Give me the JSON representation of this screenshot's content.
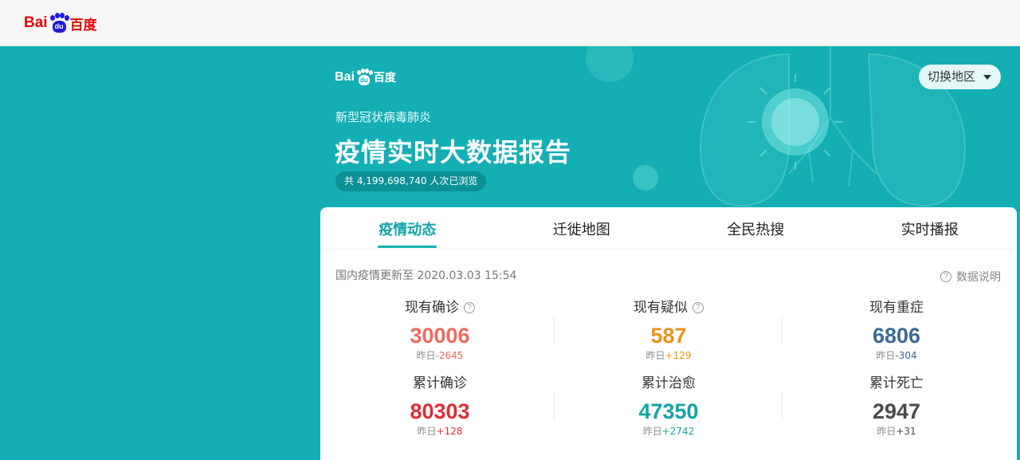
{
  "topbar": {
    "logo": {
      "bai": "Bai",
      "du": "du",
      "cn": "百度"
    }
  },
  "banner": {
    "logo": {
      "bai": "Bai",
      "du": "du",
      "cn": "百度"
    },
    "subtitle": "新型冠状病毒肺炎",
    "title": "疫情实时大数据报告",
    "views": "共 4,199,698,740 人次已浏览",
    "region_button": "切换地区"
  },
  "tabs": [
    {
      "label": "疫情动态",
      "active": true
    },
    {
      "label": "迁徙地图",
      "active": false
    },
    {
      "label": "全民热搜",
      "active": false
    },
    {
      "label": "实时播报",
      "active": false
    }
  ],
  "update_text": "国内疫情更新至 2020.03.03 15:54",
  "explain_label": "数据说明",
  "stats": [
    {
      "label": "现有确诊",
      "value": "30006",
      "delta_prefix": "昨日",
      "delta": "-2645",
      "color": "#f06a5e",
      "delta_color": "#f06a5e",
      "help": true
    },
    {
      "label": "现有疑似",
      "value": "587",
      "delta_prefix": "昨日",
      "delta": "+129",
      "color": "#ec9217",
      "delta_color": "#ec9217",
      "help": true
    },
    {
      "label": "现有重症",
      "value": "6806",
      "delta_prefix": "昨日",
      "delta": "-304",
      "color": "#3c6a93",
      "delta_color": "#3c6a93",
      "help": false
    },
    {
      "label": "累计确诊",
      "value": "80303",
      "delta_prefix": "昨日",
      "delta": "+128",
      "color": "#e02c36",
      "delta_color": "#e02c36",
      "help": false
    },
    {
      "label": "累计治愈",
      "value": "47350",
      "delta_prefix": "昨日",
      "delta": "+2742",
      "color": "#12a5a7",
      "delta_color": "#12a5a7",
      "help": false
    },
    {
      "label": "累计死亡",
      "value": "2947",
      "delta_prefix": "昨日",
      "delta": "+31",
      "color": "#4b4b4b",
      "delta_color": "#4b4b4b",
      "help": false
    }
  ]
}
